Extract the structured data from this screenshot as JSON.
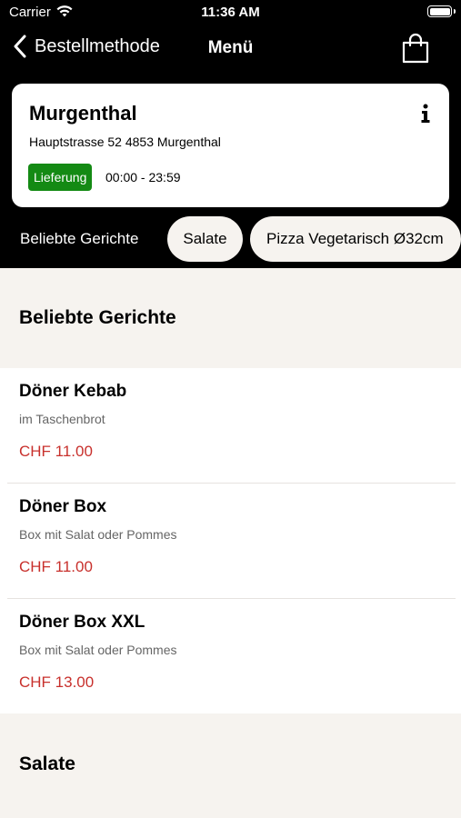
{
  "status_bar": {
    "carrier": "Carrier",
    "time": "11:36 AM"
  },
  "nav": {
    "back_label": "Bestellmethode",
    "title": "Menü"
  },
  "store": {
    "name": "Murgenthal",
    "address": "Hauptstrasse 52 4853 Murgenthal",
    "delivery_badge": "Lieferung",
    "hours": "00:00 - 23:59"
  },
  "tabs": [
    {
      "label": "Beliebte Gerichte"
    },
    {
      "label": "Salate"
    },
    {
      "label": "Pizza Vegetarisch Ø32cm"
    }
  ],
  "sections": [
    {
      "title": "Beliebte Gerichte",
      "items": [
        {
          "name": "Döner Kebab",
          "description": "im Taschenbrot",
          "price": "CHF 11.00"
        },
        {
          "name": "Döner Box",
          "description": "Box mit Salat oder Pommes",
          "price": "CHF 11.00"
        },
        {
          "name": "Döner Box XXL",
          "description": "Box mit Salat oder Pommes",
          "price": "CHF 13.00"
        }
      ]
    },
    {
      "title": "Salate"
    }
  ],
  "colors": {
    "header_bg": "#000000",
    "page_bg": "#f6f3ef",
    "badge_green": "#148a14",
    "price_red": "#c8302c"
  },
  "icons": [
    "wifi-icon",
    "battery-icon",
    "back-chevron-icon",
    "shopping-bag-icon",
    "info-icon"
  ]
}
